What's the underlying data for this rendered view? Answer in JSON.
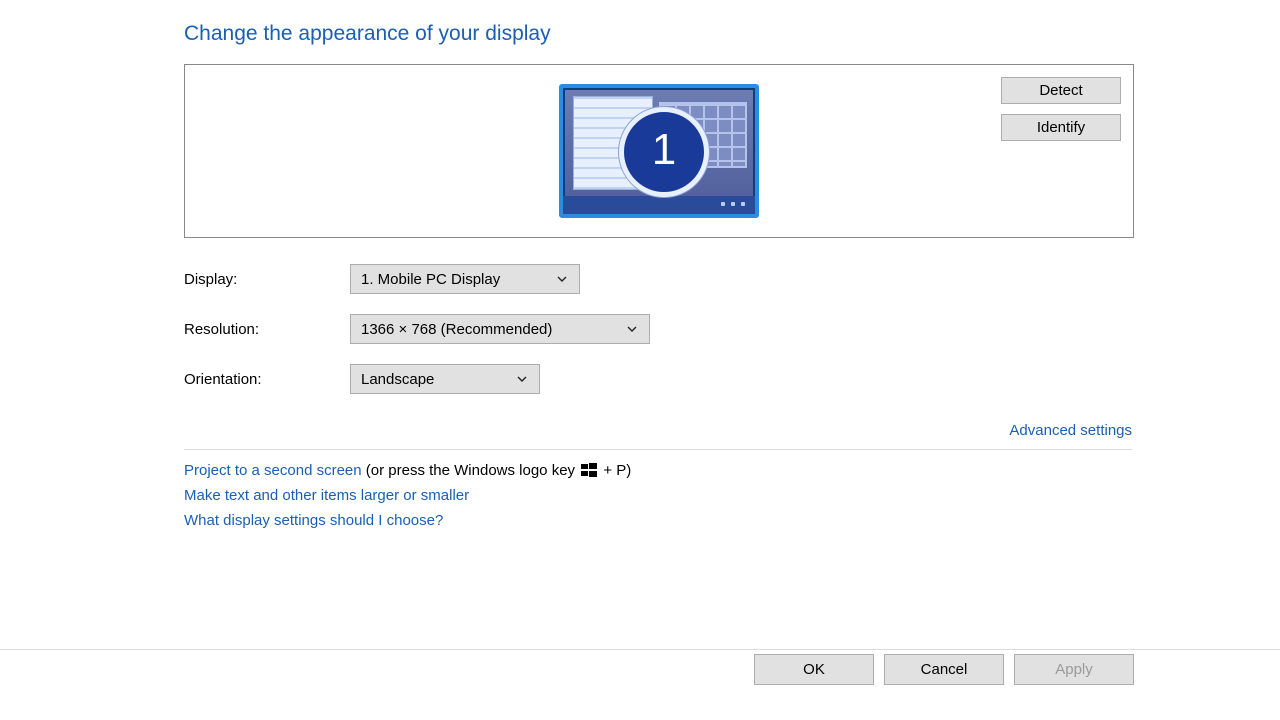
{
  "heading": "Change the appearance of your display",
  "monitor_number": "1",
  "buttons": {
    "detect": "Detect",
    "identify": "Identify",
    "ok": "OK",
    "cancel": "Cancel",
    "apply": "Apply"
  },
  "labels": {
    "display": "Display:",
    "resolution": "Resolution:",
    "orientation": "Orientation:"
  },
  "values": {
    "display": "1. Mobile PC Display",
    "resolution": "1366 × 768 (Recommended)",
    "orientation": "Landscape"
  },
  "links": {
    "advanced": "Advanced settings",
    "project": "Project to a second screen",
    "project_hint": " (or press the Windows logo key ",
    "project_hint2": " + P)",
    "textsize": "Make text and other items larger or smaller",
    "which": "What display settings should I choose?"
  }
}
